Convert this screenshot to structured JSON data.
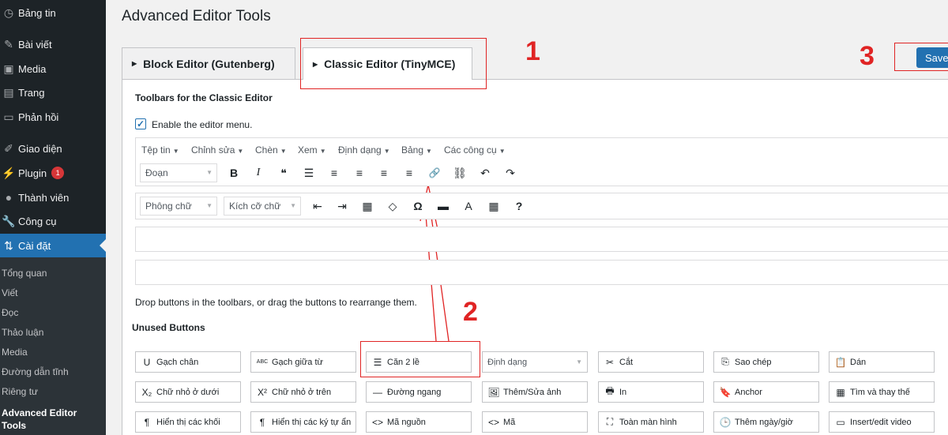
{
  "sidebar": {
    "items": [
      {
        "label": "Bảng tin",
        "icon": "dashboard-icon"
      },
      {
        "label": "Bài viết",
        "icon": "pin-icon"
      },
      {
        "label": "Media",
        "icon": "media-icon"
      },
      {
        "label": "Trang",
        "icon": "page-icon"
      },
      {
        "label": "Phản hồi",
        "icon": "comment-icon"
      },
      {
        "label": "Giao diện",
        "icon": "brush-icon"
      },
      {
        "label": "Plugin",
        "icon": "plugin-icon",
        "badge": "1"
      },
      {
        "label": "Thành viên",
        "icon": "user-icon"
      },
      {
        "label": "Công cụ",
        "icon": "wrench-icon"
      },
      {
        "label": "Cài đặt",
        "icon": "settings-icon"
      }
    ],
    "submenu": [
      "Tổng quan",
      "Viết",
      "Đọc",
      "Thảo luận",
      "Media",
      "Đường dẫn tĩnh",
      "Riêng tư",
      "Advanced Editor Tools"
    ]
  },
  "page": {
    "title": "Advanced Editor Tools",
    "tabs": [
      "Block Editor (Gutenberg)",
      "Classic Editor (TinyMCE)"
    ],
    "save_label": "Save",
    "section_title": "Toolbars for the Classic Editor",
    "enable_menu_label": "Enable the editor menu.",
    "drop_hint": "Drop buttons in the toolbars, or drag the buttons to rearrange them.",
    "unused_title": "Unused Buttons"
  },
  "annotations": [
    "1",
    "2",
    "3"
  ],
  "editor": {
    "menu": [
      "Tệp tin",
      "Chỉnh sửa",
      "Chèn",
      "Xem",
      "Định dạng",
      "Bảng",
      "Các công cụ"
    ],
    "format_select": "Đoạn",
    "font_select": "Phông chữ",
    "size_select": "Kích cỡ chữ",
    "row1_icons": [
      "B",
      "I",
      "❝",
      "☰",
      "≡",
      "≡",
      "≡",
      "≡",
      "🔗",
      "⛓",
      "↶",
      "↷"
    ],
    "row2_icons": [
      "⇤",
      "⇥",
      "▦",
      "◇",
      "Ω",
      "▬",
      "A",
      "▦",
      "?"
    ]
  },
  "unused_buttons": [
    [
      "Gạch chân",
      "Gạch giữa từ",
      "Căn 2 lề",
      "Định dạng",
      "Cắt",
      "Sao chép",
      "Dán"
    ],
    [
      "Chữ nhỏ ở dưới",
      "Chữ nhỏ ở trên",
      "Đường ngang",
      "Thêm/Sửa ảnh",
      "In",
      "Anchor",
      "Tìm và thay thế"
    ],
    [
      "Hiển thị các khối",
      "Hiển thị các ký tự ẩn",
      "Mã nguồn",
      "Mã",
      "Toàn màn hình",
      "Thêm ngày/giờ",
      "Insert/edit video"
    ]
  ],
  "unused_icons": [
    [
      "U",
      "ABC",
      "☰",
      "",
      "✂",
      "⎘",
      "📋"
    ],
    [
      "X₂",
      "X²",
      "—",
      "🖼",
      "🖶",
      "🔖",
      "▦"
    ],
    [
      "¶",
      "¶",
      "<>",
      "<>",
      "⛶",
      "🕒",
      "▭"
    ]
  ],
  "colors": {
    "sidebar_bg": "#1d2327",
    "accent": "#2271b1",
    "annotation": "#e02424"
  }
}
